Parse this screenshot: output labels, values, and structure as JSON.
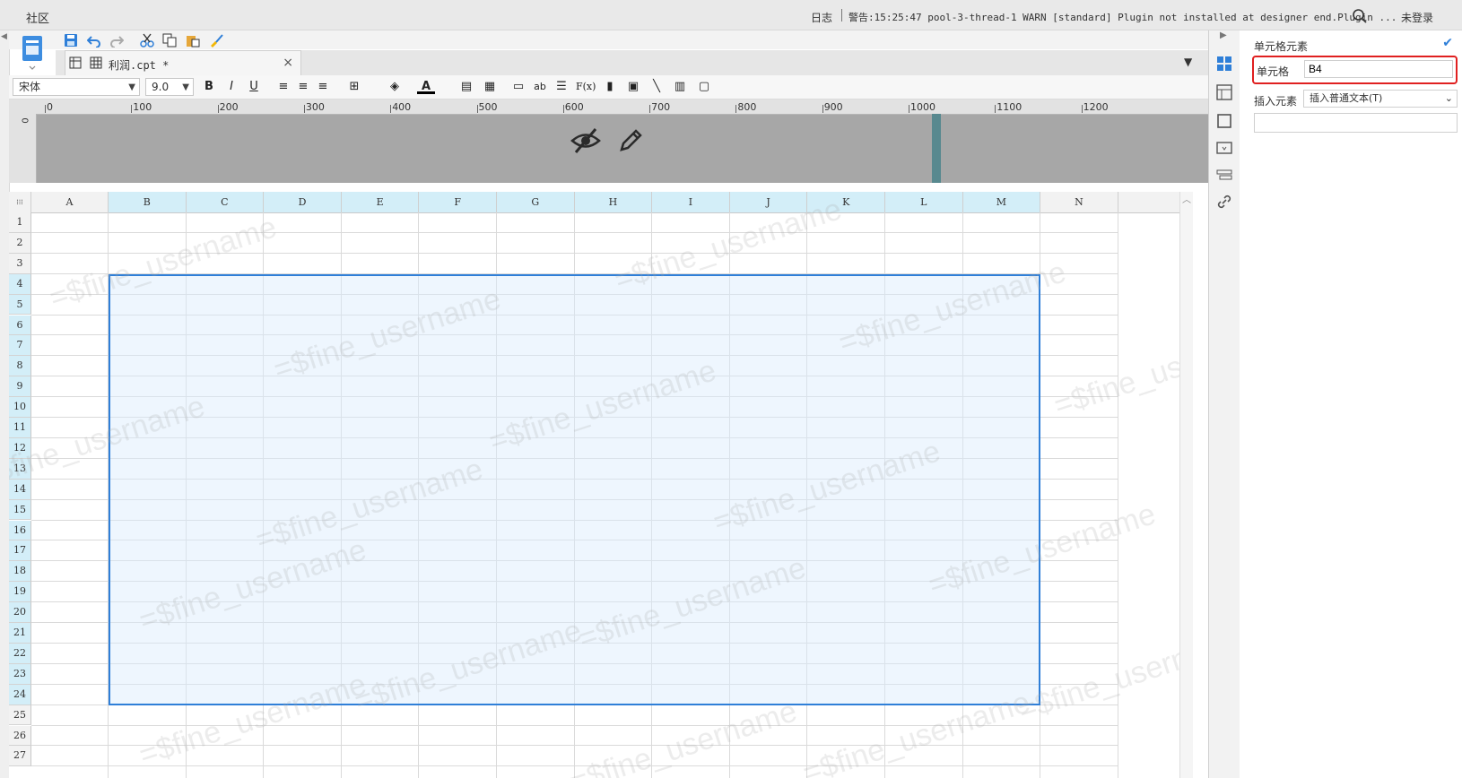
{
  "topbar": {
    "community": "社区",
    "log": "日志",
    "warning": "警告:15:25:47 pool-3-thread-1 WARN [standard] Plugin not installed at designer end.Plugin ...",
    "login": "未登录"
  },
  "tab": {
    "filename": "利润.cpt *",
    "close": "×"
  },
  "format": {
    "font": "宋体",
    "size": "9.0",
    "bold": "B",
    "italic": "I",
    "underline": "U",
    "ab": "ab",
    "fx": "F(x)"
  },
  "ruler": {
    "marks": [
      "0",
      "100",
      "200",
      "300",
      "400",
      "500",
      "600",
      "700",
      "800",
      "900",
      "1000",
      "1100",
      "1200"
    ],
    "vmark": "0"
  },
  "grid": {
    "columns": [
      "A",
      "B",
      "C",
      "D",
      "E",
      "F",
      "G",
      "H",
      "I",
      "J",
      "K",
      "L",
      "M",
      "N"
    ],
    "rows": [
      "1",
      "2",
      "3",
      "4",
      "5",
      "6",
      "7",
      "8",
      "9",
      "10",
      "11",
      "12",
      "13",
      "14",
      "15",
      "16",
      "17",
      "18",
      "19",
      "20",
      "21",
      "22",
      "23",
      "24",
      "25",
      "26",
      "27"
    ],
    "selected_range": "B4:M24",
    "watermark": "=$fine_username"
  },
  "panel": {
    "title": "单元格元素",
    "cell_label": "单元格",
    "cell_value": "B4",
    "insert_label": "插入元素",
    "insert_value": "插入普通文本(T)"
  },
  "colors": {
    "selection": "#2f7fd8",
    "highlight": "#d3eef8",
    "callout": "#e02020"
  }
}
